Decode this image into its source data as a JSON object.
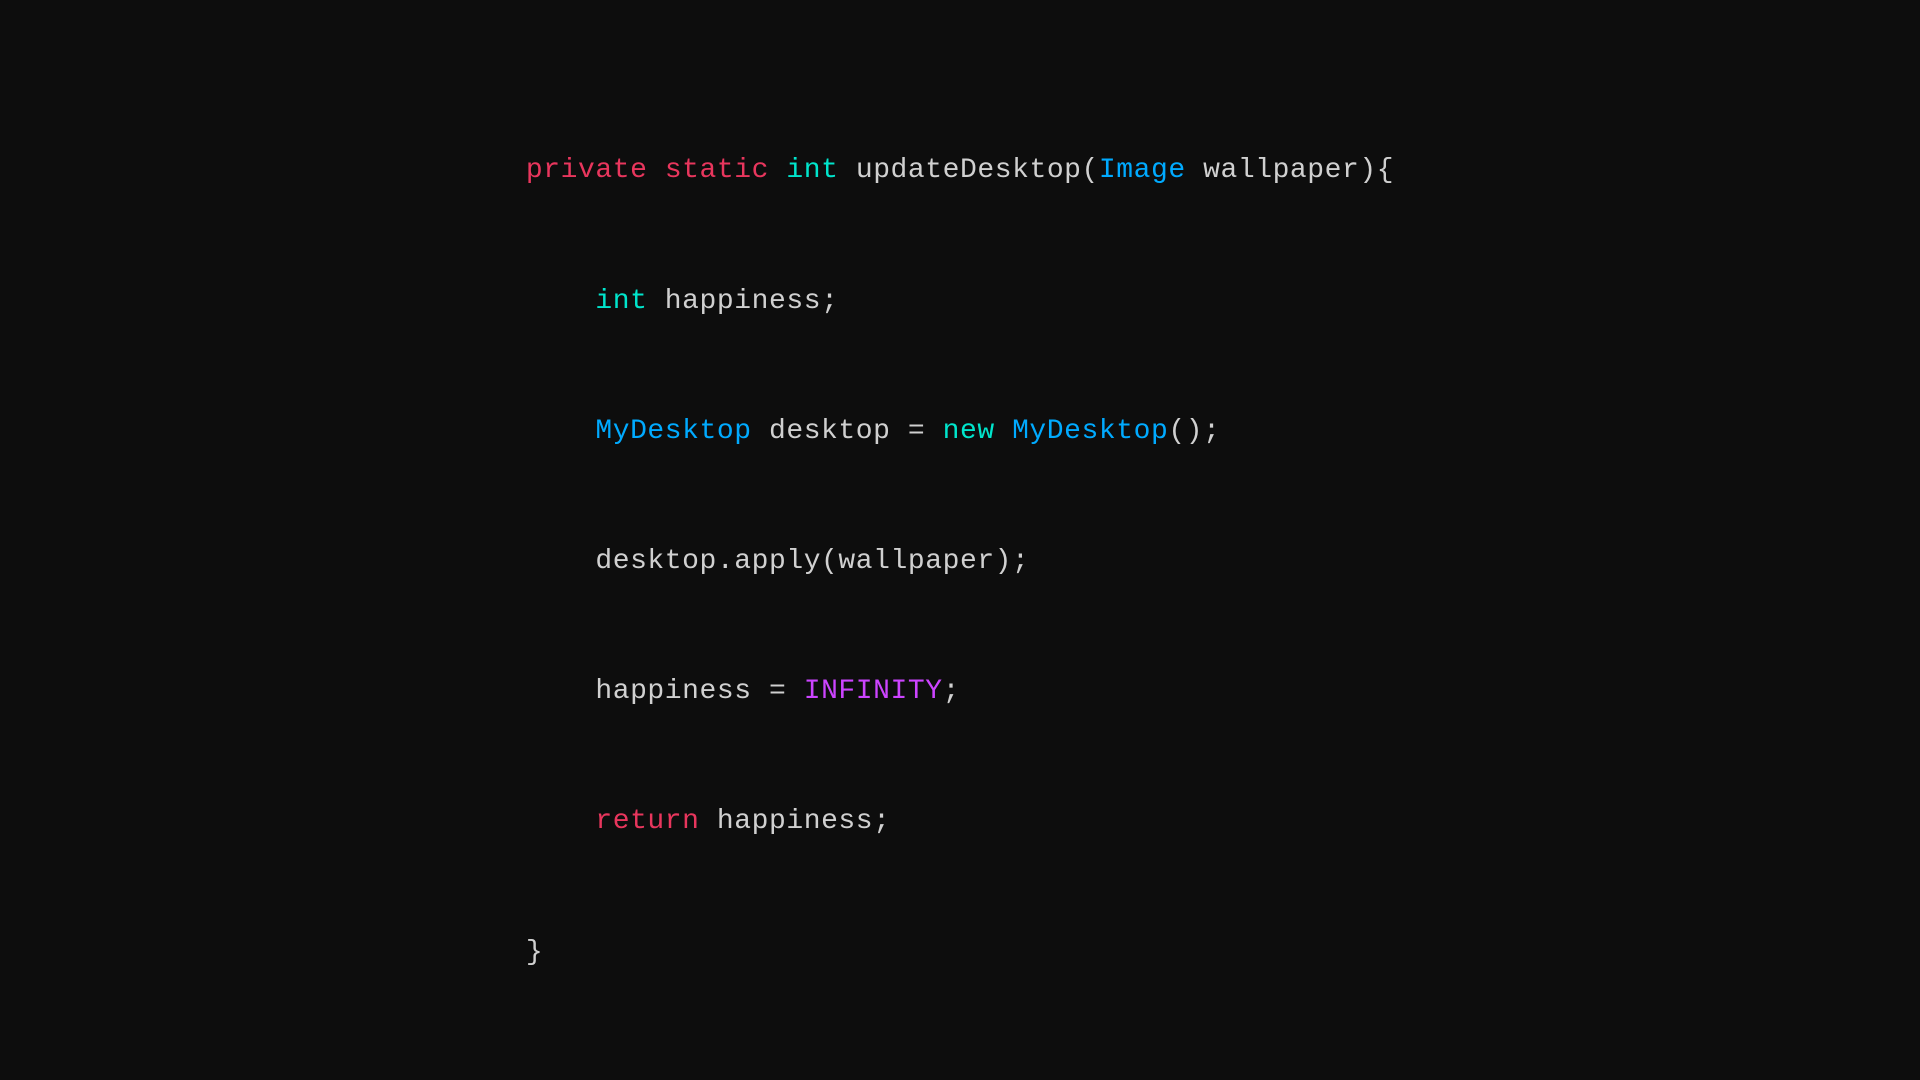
{
  "code": {
    "line1": {
      "private": "private",
      "static": "static",
      "int": "int",
      "rest": " updateDesktop(",
      "Image": "Image",
      "wallpaper": " wallpaper){"
    },
    "line2": {
      "int": "int",
      "rest": " happiness;"
    },
    "line3": {
      "MyDesktop1": "MyDesktop",
      "middle": " desktop = ",
      "new": "new",
      "MyDesktop2": " MyDesktop",
      "end": "();"
    },
    "line4": {
      "text": "desktop.apply(wallpaper);"
    },
    "line5": {
      "happiness": "happiness",
      "equals": " = ",
      "INFINITY": "INFINITY",
      "semi": ";"
    },
    "line6": {
      "return": "return",
      "rest": " happiness;"
    },
    "line7": {
      "brace": "}"
    }
  },
  "indent": "    ",
  "indent2": "        "
}
